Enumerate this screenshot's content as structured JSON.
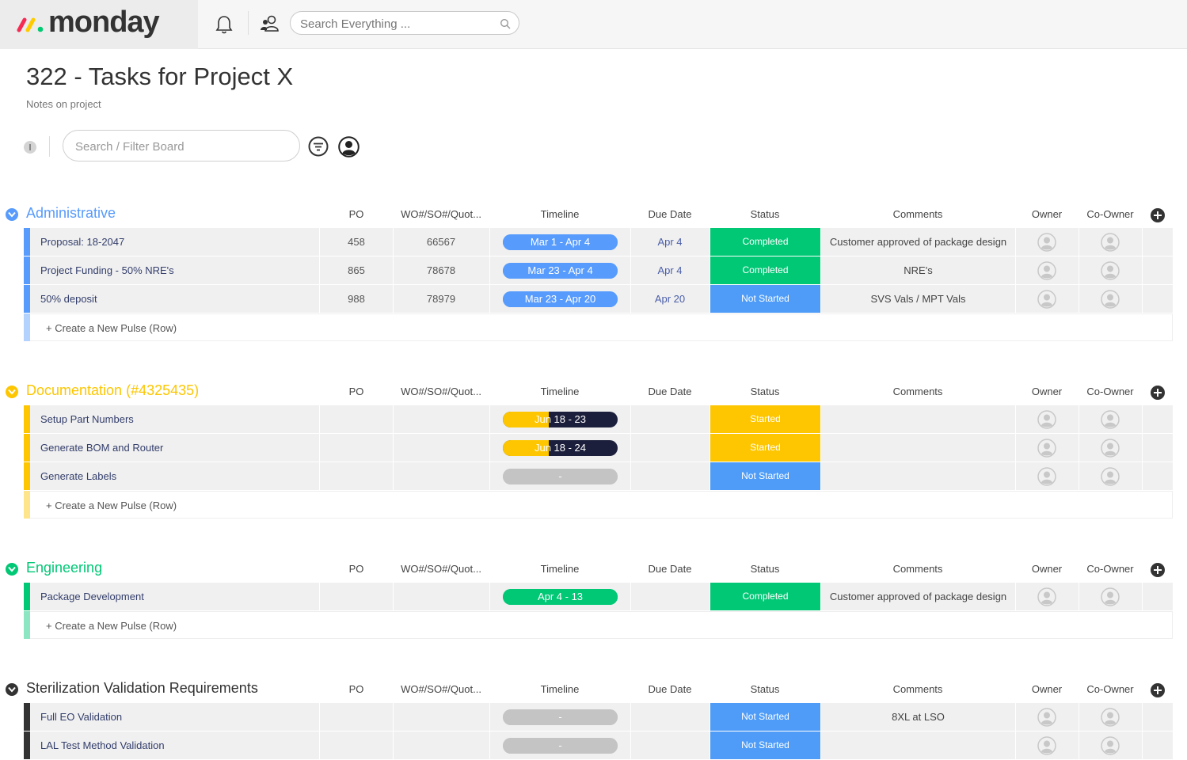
{
  "app": {
    "logo_text": "monday"
  },
  "topbar": {
    "search_placeholder": "Search Everything ..."
  },
  "board": {
    "title": "322 - Tasks for Project X",
    "description": "Notes on project",
    "search_placeholder": "Search / Filter Board"
  },
  "columns": {
    "po": "PO",
    "wo": "WO#/SO#/Quot...",
    "timeline": "Timeline",
    "due": "Due Date",
    "status": "Status",
    "comments": "Comments",
    "owner": "Owner",
    "coowner": "Co-Owner"
  },
  "colors": {
    "blue": "#579bfc",
    "yellow": "#fdc600",
    "green": "#00c875",
    "dark": "#333333",
    "navy": "#1c1f3b",
    "grey_pill": "#c4c4c4",
    "status_blue": "#4e9cf7"
  },
  "new_row_label": "+ Create a New Pulse (Row)",
  "groups": [
    {
      "name": "Administrative",
      "color": "#579bfc",
      "rows": [
        {
          "name": "Proposal: 18-2047",
          "po": "458",
          "wo": "66567",
          "timeline": "Mar 1 - Apr 4",
          "timeline_color": "#579bfc",
          "timeline_progress": 1,
          "due": "Apr 4",
          "status": "Completed",
          "status_color": "#00c875",
          "comment": "Customer approved of package design"
        },
        {
          "name": "Project Funding - 50% NRE's",
          "po": "865",
          "wo": "78678",
          "timeline": "Mar 23 - Apr 4",
          "timeline_color": "#579bfc",
          "timeline_progress": 1,
          "due": "Apr 4",
          "status": "Completed",
          "status_color": "#00c875",
          "comment": "NRE's"
        },
        {
          "name": "50% deposit",
          "po": "988",
          "wo": "78979",
          "timeline": "Mar 23 - Apr 20",
          "timeline_color": "#579bfc",
          "timeline_progress": 1,
          "due": "Apr 20",
          "status": "Not Started",
          "status_color": "#4e9cf7",
          "comment": "SVS Vals / MPT Vals"
        }
      ]
    },
    {
      "name": "Documentation (#4325435)",
      "color": "#fdc600",
      "rows": [
        {
          "name": "Setup Part Numbers",
          "po": "",
          "wo": "",
          "timeline": "Jun 18 - 23",
          "timeline_color": "#fdc600",
          "timeline_progress": 0.4,
          "due": "",
          "status": "Started",
          "status_color": "#fdc600",
          "comment": ""
        },
        {
          "name": "Generate BOM and Router",
          "po": "",
          "wo": "",
          "timeline": "Jun 18 - 24",
          "timeline_color": "#fdc600",
          "timeline_progress": 0.4,
          "due": "",
          "status": "Started",
          "status_color": "#fdc600",
          "comment": ""
        },
        {
          "name": "Generate Labels",
          "po": "",
          "wo": "",
          "timeline": "-",
          "timeline_color": "#c4c4c4",
          "timeline_progress": 1,
          "due": "",
          "status": "Not Started",
          "status_color": "#4e9cf7",
          "comment": ""
        }
      ]
    },
    {
      "name": "Engineering",
      "color": "#00c875",
      "rows": [
        {
          "name": "Package Development",
          "po": "",
          "wo": "",
          "timeline": "Apr 4 - 13",
          "timeline_color": "#00c875",
          "timeline_progress": 1,
          "due": "",
          "status": "Completed",
          "status_color": "#00c875",
          "comment": "Customer approved of package design"
        }
      ]
    },
    {
      "name": "Sterilization Validation Requirements",
      "color": "#333333",
      "rows": [
        {
          "name": "Full EO Validation",
          "po": "",
          "wo": "",
          "timeline": "-",
          "timeline_color": "#c4c4c4",
          "timeline_progress": 1,
          "due": "",
          "status": "Not Started",
          "status_color": "#4e9cf7",
          "comment": "8XL at LSO"
        },
        {
          "name": "LAL Test Method Validation",
          "po": "",
          "wo": "",
          "timeline": "-",
          "timeline_color": "#c4c4c4",
          "timeline_progress": 1,
          "due": "",
          "status": "Not Started",
          "status_color": "#4e9cf7",
          "comment": ""
        }
      ]
    }
  ]
}
